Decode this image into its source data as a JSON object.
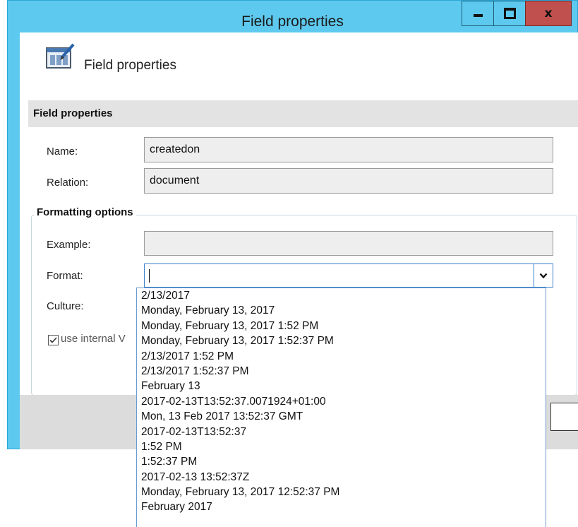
{
  "window": {
    "title": "Field properties",
    "minimize_icon": "minimize-icon",
    "maximize_icon": "maximize-icon",
    "close_icon": "close-icon",
    "close_glyph": "x"
  },
  "header": {
    "title": "Field properties",
    "icon": "table-edit-icon"
  },
  "section": {
    "label": "Field properties"
  },
  "fields": {
    "name_label": "Name:",
    "name_value": "createdon",
    "relation_label": "Relation:",
    "relation_value": "document"
  },
  "formatting": {
    "legend": "Formatting options",
    "example_label": "Example:",
    "example_value": "",
    "format_label": "Format:",
    "format_value": "",
    "culture_label": "Culture:",
    "checkbox_label": "use internal V",
    "checkbox_checked": true
  },
  "dropdown": {
    "options": [
      "2/13/2017",
      "Monday, February 13, 2017",
      "Monday, February 13, 2017 1:52 PM",
      "Monday, February 13, 2017 1:52:37 PM",
      "2/13/2017 1:52 PM",
      "2/13/2017 1:52:37 PM",
      "February 13",
      "2017-02-13T13:52:37.0071924+01:00",
      "Mon, 13 Feb 2017 13:52:37 GMT",
      "2017-02-13T13:52:37",
      "1:52 PM",
      "1:52:37 PM",
      "2017-02-13 13:52:37Z",
      "Monday, February 13, 2017 12:52:37 PM",
      "February 2017"
    ]
  },
  "colors": {
    "title_bar": "#5ec9ee",
    "close_button": "#c0504d",
    "section_bar": "#e3e3e3",
    "footer": "#dcdcdc"
  }
}
